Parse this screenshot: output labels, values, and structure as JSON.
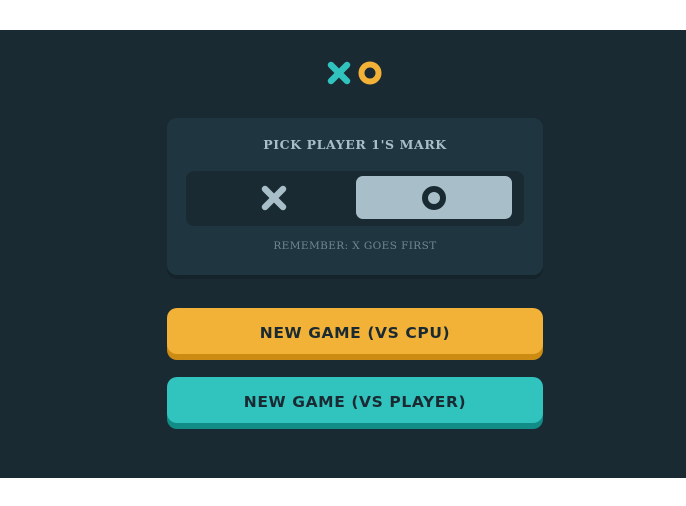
{
  "colors": {
    "background": "#1a2a33",
    "panel": "#1f3641",
    "silver": "#a8bfc9",
    "light_blue": "#31c3bd",
    "light_yellow": "#f2b137"
  },
  "logo": {
    "icons": [
      "x-icon",
      "o-icon"
    ]
  },
  "mark_picker": {
    "title": "PICK PLAYER 1'S MARK",
    "options": [
      {
        "mark": "X",
        "icon": "x-icon",
        "selected": false
      },
      {
        "mark": "O",
        "icon": "o-icon",
        "selected": true
      }
    ],
    "hint": "REMEMBER: X GOES FIRST"
  },
  "buttons": {
    "vs_cpu": "NEW GAME (VS CPU)",
    "vs_player": "NEW GAME (VS PLAYER)"
  }
}
